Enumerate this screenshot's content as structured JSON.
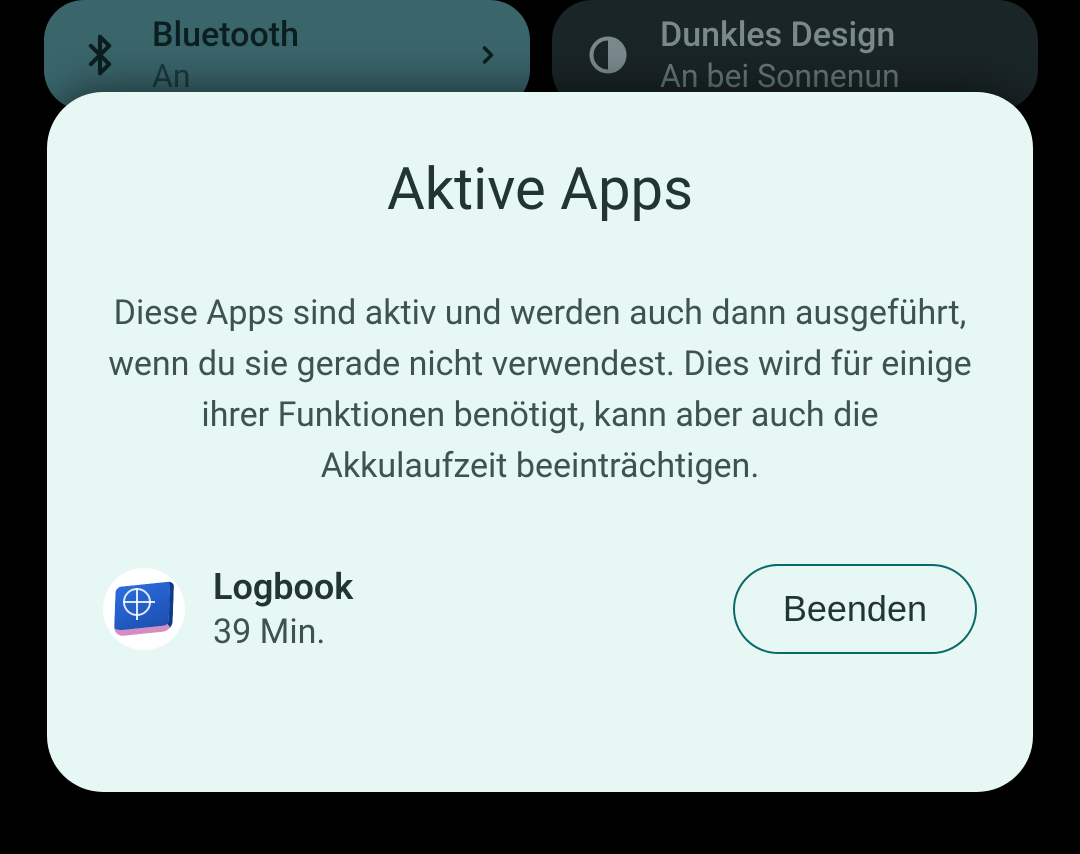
{
  "quick_settings": {
    "bluetooth": {
      "title": "Bluetooth",
      "status": "An"
    },
    "dark_mode": {
      "title": "Dunkles Design",
      "status": "An bei Sonnenun"
    }
  },
  "sheet": {
    "title": "Aktive Apps",
    "description": "Diese Apps sind aktiv und werden auch dann ausgeführt, wenn du sie gerade nicht verwendest. Dies wird für einige ihrer Funktionen benötigt, kann aber auch die Akkulaufzeit beeinträchtigen.",
    "apps": [
      {
        "name": "Logbook",
        "duration": "39 Min.",
        "stop_label": "Beenden"
      }
    ]
  }
}
